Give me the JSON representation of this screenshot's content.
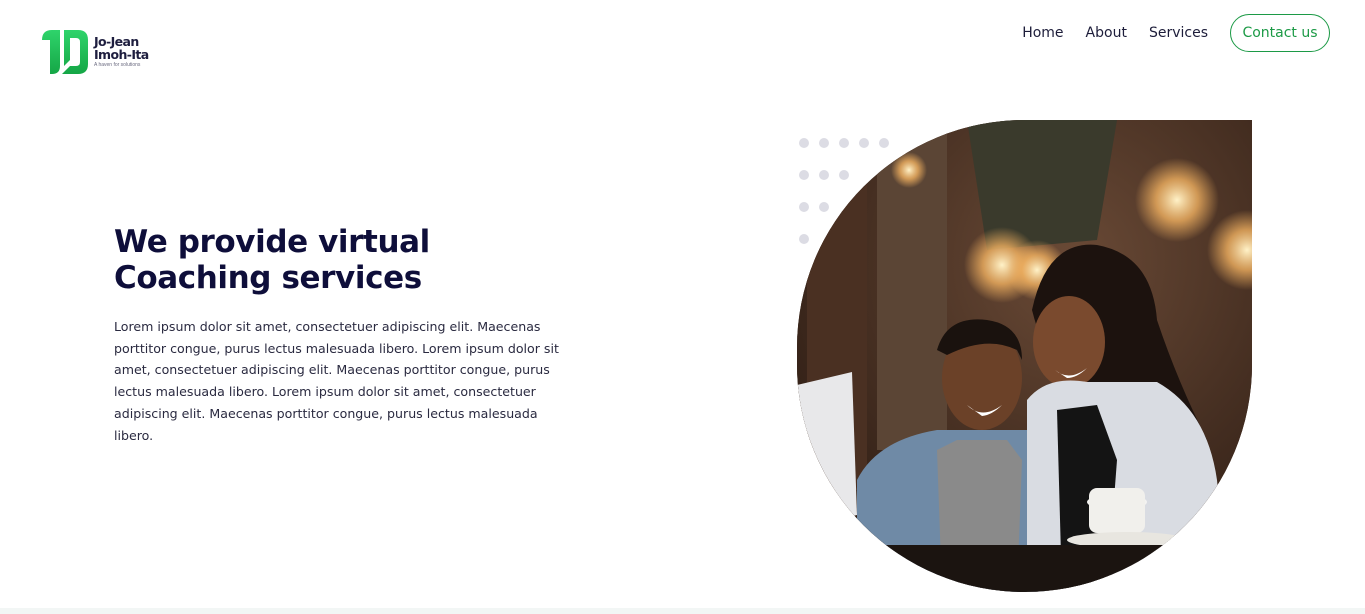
{
  "brand": {
    "line1": "Jo-Jean",
    "line2": "Imoh-Ita",
    "tagline": "A haven for solutions",
    "accent_color": "#1c9a46"
  },
  "nav": {
    "items": [
      {
        "label": "Home"
      },
      {
        "label": "About"
      },
      {
        "label": "Services"
      }
    ],
    "cta_label": "Contact us"
  },
  "hero": {
    "title_line1": "We provide virtual",
    "title_line2": "Coaching services",
    "body": "Lorem ipsum dolor sit amet, consectetuer adipiscing elit. Maecenas porttitor congue, purus lectus malesuada libero. Lorem ipsum dolor sit amet, consectetuer adipiscing elit. Maecenas porttitor congue, purus lectus malesuada libero. Lorem ipsum dolor sit amet, consectetuer adipiscing elit. Maecenas porttitor congue, purus lectus malesuada libero.",
    "image_icon": "photo-couple-laptop-cafe"
  }
}
